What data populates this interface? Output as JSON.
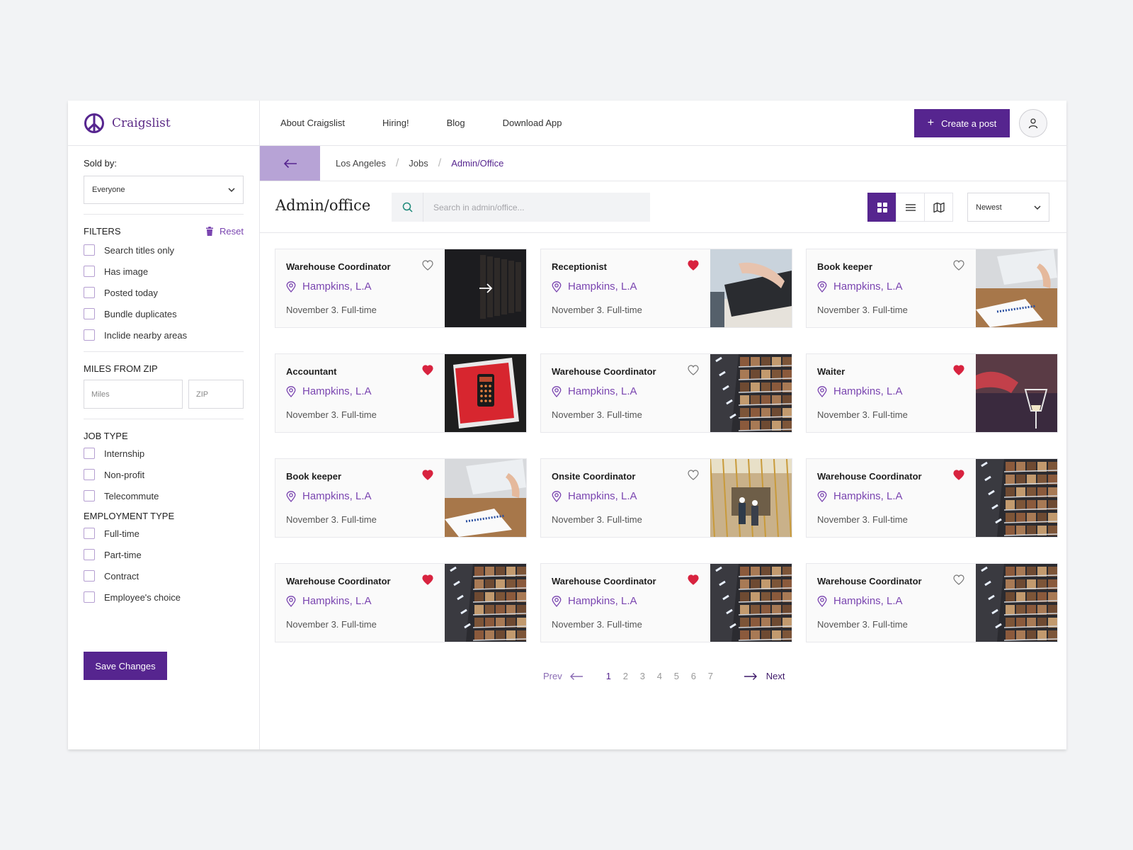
{
  "app": {
    "name": "Craigslist",
    "accent": "#56258f",
    "accent_light": "#b7a3d6",
    "heart_color": "#d8233f"
  },
  "nav": {
    "links": [
      "About Craigslist",
      "Hiring!",
      "Blog",
      "Download App"
    ],
    "create_label": "Create a post"
  },
  "breadcrumb": [
    "Los Angeles",
    "Jobs",
    "Admin/Office"
  ],
  "toolbar": {
    "title": "Admin/office",
    "search_placeholder": "Search in admin/office...",
    "sort_value": "Newest",
    "view_active": "grid"
  },
  "sidebar": {
    "sold_by_label": "Sold by:",
    "sold_by_value": "Everyone",
    "filters_label": "FILTERS",
    "reset_label": "Reset",
    "filters": [
      "Search titles only",
      "Has image",
      "Posted today",
      "Bundle duplicates",
      "Inclide nearby areas"
    ],
    "miles_label": "MILES FROM ZIP",
    "miles_placeholder": "Miles",
    "zip_placeholder": "ZIP",
    "job_type_label": "JOB TYPE",
    "job_types": [
      "Internship",
      "Non-profit",
      "Telecommute"
    ],
    "employment_label": "EMPLOYMENT TYPE",
    "employment_types": [
      "Full-time",
      "Part-time",
      "Contract",
      "Employee's choice"
    ],
    "save_label": "Save Changes"
  },
  "listings": [
    {
      "title": "Warehouse Coordinator",
      "location": "Hampkins, L.A",
      "meta": "November 3. Full-time",
      "favorited": false,
      "image": "warehouse-dark-arrow"
    },
    {
      "title": "Receptionist",
      "location": "Hampkins, L.A",
      "meta": "November 3. Full-time",
      "favorited": true,
      "image": "keyboard-typing"
    },
    {
      "title": "Book keeper",
      "location": "Hampkins, L.A",
      "meta": "November 3. Full-time",
      "favorited": false,
      "image": "desk-documents"
    },
    {
      "title": "Accountant",
      "location": "Hampkins, L.A",
      "meta": "November 3. Full-time",
      "favorited": true,
      "image": "calculator"
    },
    {
      "title": "Warehouse Coordinator",
      "location": "Hampkins, L.A",
      "meta": "November 3. Full-time",
      "favorited": false,
      "image": "warehouse-shelves"
    },
    {
      "title": "Waiter",
      "location": "Hampkins, L.A",
      "meta": "November 3. Full-time",
      "favorited": true,
      "image": "wine-pour"
    },
    {
      "title": "Book keeper",
      "location": "Hampkins, L.A",
      "meta": "November 3. Full-time",
      "favorited": true,
      "image": "desk-documents"
    },
    {
      "title": "Onsite Coordinator",
      "location": "Hampkins, L.A",
      "meta": "November 3. Full-time",
      "favorited": false,
      "image": "construction-site"
    },
    {
      "title": "Warehouse Coordinator",
      "location": "Hampkins, L.A",
      "meta": "November 3. Full-time",
      "favorited": true,
      "image": "warehouse-shelves"
    },
    {
      "title": "Warehouse Coordinator",
      "location": "Hampkins, L.A",
      "meta": "November 3. Full-time",
      "favorited": true,
      "image": "warehouse-shelves"
    },
    {
      "title": "Warehouse Coordinator",
      "location": "Hampkins, L.A",
      "meta": "November 3. Full-time",
      "favorited": true,
      "image": "warehouse-shelves"
    },
    {
      "title": "Warehouse Coordinator",
      "location": "Hampkins, L.A",
      "meta": "November 3. Full-time",
      "favorited": false,
      "image": "warehouse-shelves"
    }
  ],
  "pagination": {
    "prev_label": "Prev",
    "next_label": "Next",
    "pages": [
      "1",
      "2",
      "3",
      "4",
      "5",
      "6",
      "7"
    ],
    "current": "1"
  }
}
